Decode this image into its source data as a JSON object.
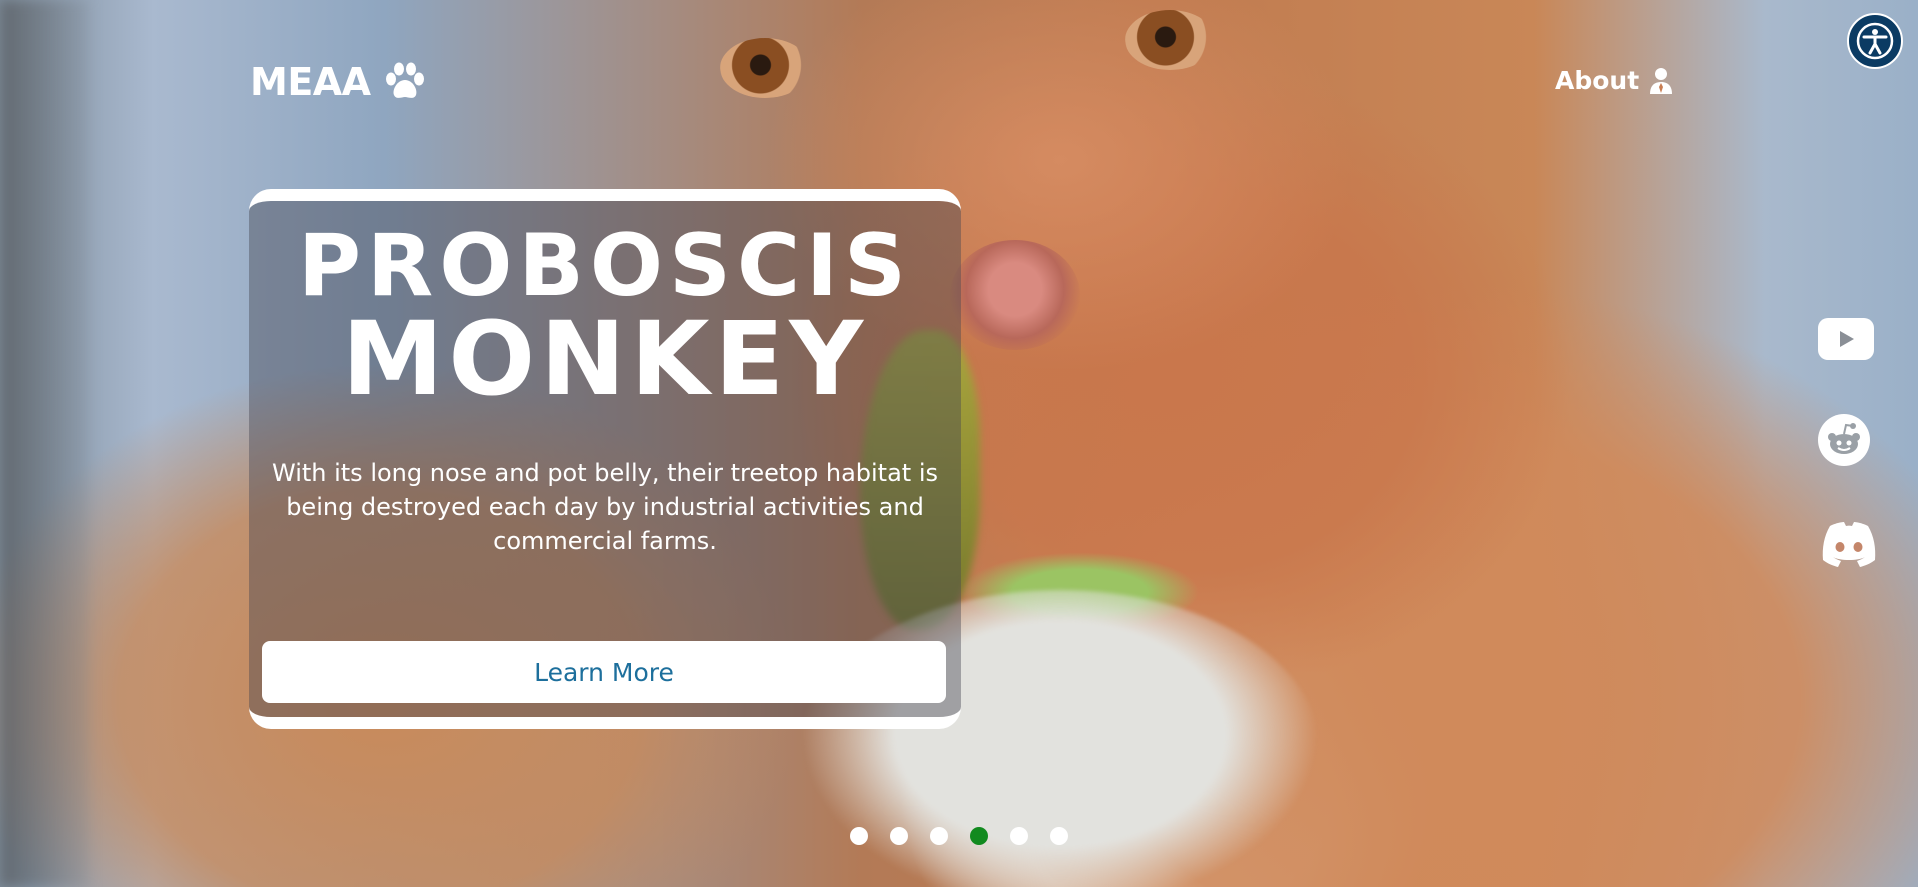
{
  "header": {
    "logo_text": "MEAA",
    "about_label": "About"
  },
  "hero": {
    "title_line1": "PROBOSCIS",
    "title_line2": "MONKEY",
    "description": "With its long nose and pot belly, their treetop habitat is being destroyed each day by industrial activities and commercial farms.",
    "button_label": "Learn More"
  },
  "carousel": {
    "slide_count": 6,
    "active_index": 3
  },
  "social": [
    "youtube-icon",
    "reddit-icon",
    "discord-icon"
  ],
  "colors": {
    "accessibility_bg": "#0b3b63",
    "button_text": "#1d6f9c",
    "active_dot": "#128a1f"
  }
}
